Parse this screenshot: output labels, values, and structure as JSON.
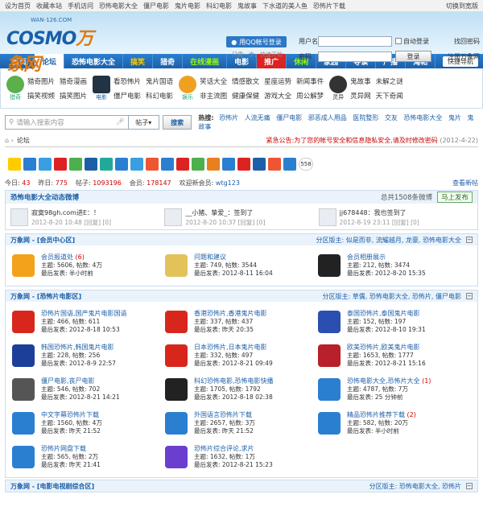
{
  "topbar": {
    "links": [
      "设为首页",
      "收藏本站",
      "手机访问",
      "恐怖电影大全",
      "僵尸电影",
      "鬼片电影",
      "科幻电影",
      "鬼故事",
      "下水道的美人鱼",
      "恐怖片下载"
    ],
    "right": "切换到宽版"
  },
  "header": {
    "logo_url": "WAN-126.COM",
    "logo_brand": "COSMO",
    "logo_brand2": "万象网",
    "qq_button": "用QQ帐号登录",
    "qq_tip": "只需一步，快速开始",
    "username_label": "用户名",
    "password_label": "密码",
    "auto_login": "自动登录",
    "find_password": "找回密码",
    "login_button": "登录",
    "register": "注册万象网"
  },
  "nav": {
    "items": [
      "首页",
      "论坛",
      "恐怖电影大全",
      "搞笑",
      "猎奇",
      "在线漫画",
      "电影",
      "推广",
      "休闲",
      "家园",
      "导读",
      "广播",
      "淘帖"
    ],
    "quick": "快捷导航"
  },
  "subnav": {
    "groups": [
      {
        "icon_label": "猎奇",
        "links": [
          "猎奇图片",
          "猎奇漫画",
          "搞笑视频",
          "搞笑图片"
        ]
      },
      {
        "icon_label": "电影",
        "links": [
          "看恐怖片",
          "鬼片国语",
          "僵尸电影",
          "科幻电影"
        ]
      },
      {
        "icon_label": "娱乐",
        "links": [
          "笑话大全",
          "情感散文",
          "星座运势",
          "新闻事件",
          "非主流图",
          "健康保健",
          "游戏大全",
          "周公解梦"
        ]
      },
      {
        "icon_label": "灵异",
        "links": [
          "鬼故事",
          "未解之谜",
          "灵异网",
          "天下奇闻"
        ]
      }
    ]
  },
  "search": {
    "placeholder": "请输入搜索内容",
    "select": "帖子",
    "button": "搜索",
    "hot_label": "热搜:",
    "hot": [
      "恐怖片",
      "人流无痛",
      "僵尸电影",
      "邪恶成人用品",
      "医院整形",
      "交友",
      "恐怖电影大全",
      "鬼片",
      "鬼故事"
    ]
  },
  "notice": {
    "breadcrumb": "论坛",
    "announce": "紧急公告:为了您的帐号安全和信息隐私安全,请及时修改密码",
    "date": "(2012-4-22)"
  },
  "icons_count": "558",
  "stats": {
    "today_label": "今日:",
    "today": "43",
    "yesterday_label": "昨日:",
    "yesterday": "775",
    "posts_label": "帖子:",
    "posts": "1093196",
    "members_label": "会员:",
    "members": "178147",
    "newest_label": "欢迎新会员:",
    "newest": "wtg123",
    "new_posts": "查看新帖"
  },
  "weibo": {
    "title": "恐怖电影大全动态微博",
    "total": "总共1508条微博",
    "publish": "马上发布",
    "items": [
      {
        "text": "寂寞98gh.com进E：！",
        "time": "2012-8-20 10:48 [回复] [0]"
      },
      {
        "text": "__小猪、挚爱_：签到了",
        "time": "2012-8-20 10:37 [回复] [0]"
      },
      {
        "text": "jj678448：我也签到了",
        "time": "2012-8-19 23:11 [回复] [0]"
      }
    ]
  },
  "sections": [
    {
      "title": "万象网 - [会员中心区]",
      "mods_label": "分区版主:",
      "mods": "似是而非, 流耀越月, 龙豪, 恐怖电影大全",
      "forums": [
        {
          "name": "会员报道处",
          "new": "(6)",
          "topics": "主题: 5606, 帖数: 4万",
          "last": "最后发表: 半小时前",
          "color": "#f3a21b"
        },
        {
          "name": "问题和建议",
          "new": "",
          "topics": "主题: 749, 帖数: 3544",
          "last": "最后发表: 2012-8-11 16:04",
          "color": "#e3c25a"
        },
        {
          "name": "会员相册展示",
          "new": "",
          "topics": "主题: 212, 帖数: 3474",
          "last": "最后发表: 2012-8-20 15:35",
          "color": "#222"
        }
      ]
    },
    {
      "title": "万象网 - [恐怖片电影区]",
      "mods_label": "分区版主:",
      "mods": "草儒, 恐怖电影大全, 恐怖片, 僵尸电影",
      "forums": [
        {
          "name": "恐怖片国语,国产鬼片电影国语",
          "new": "",
          "topics": "主题: 466, 帖数: 611",
          "last": "最后发表: 2012-8-18 10:53",
          "color": "#d9261c"
        },
        {
          "name": "香港恐怖片,香港鬼片电影",
          "new": "",
          "topics": "主题: 337, 帖数: 437",
          "last": "最后发表: 昨天 20:35",
          "color": "#d9261c"
        },
        {
          "name": "泰国恐怖片,泰国鬼片电影",
          "new": "",
          "topics": "主题: 152, 帖数: 197",
          "last": "最后发表: 2012-8-10 19:31",
          "color": "#2a4fb0"
        },
        {
          "name": "韩国恐怖片,韩国鬼片电影",
          "new": "",
          "topics": "主题: 228, 帖数: 256",
          "last": "最后发表: 2012-8-9 22:57",
          "color": "#1c3f9a"
        },
        {
          "name": "日本恐怖片,日本鬼片电影",
          "new": "",
          "topics": "主题: 332, 帖数: 497",
          "last": "最后发表: 2012-8-21 09:49",
          "color": "#d9261c"
        },
        {
          "name": "欧美恐怖片,欧美鬼片电影",
          "new": "",
          "topics": "主题: 1653, 帖数: 1777",
          "last": "最后发表: 2012-8-21 15:16",
          "color": "#b8202a"
        },
        {
          "name": "僵尸电影,丧尸电影",
          "new": "",
          "topics": "主题: 546, 帖数: 702",
          "last": "最后发表: 2012-8-21 14:21",
          "color": "#555"
        },
        {
          "name": "科幻恐怖电影,恐怖电影快播",
          "new": "",
          "topics": "主题: 1705, 帖数: 1792",
          "last": "最后发表: 2012-8-18 02:38",
          "color": "#222"
        },
        {
          "name": "恐怖电影大全,恐怖片大全",
          "new": "(1)",
          "topics": "主题: 4787, 帖数: 7万",
          "last": "最后发表: 25 分钟前",
          "color": "#2a7fd0"
        },
        {
          "name": "中文字幕恐怖片下载",
          "new": "",
          "topics": "主题: 1560, 帖数: 4万",
          "last": "最后发表: 昨天 21:52",
          "color": "#2a7fd0"
        },
        {
          "name": "外国语言恐怖片下载",
          "new": "",
          "topics": "主题: 2657, 帖数: 3万",
          "last": "最后发表: 昨天 21:52",
          "color": "#2a7fd0"
        },
        {
          "name": "精品恐怖片推荐下载",
          "new": "(2)",
          "topics": "主题: 582, 帖数: 20万",
          "last": "最后发表: 半小时前",
          "color": "#2a7fd0"
        },
        {
          "name": "恐怖片网盘下载",
          "new": "",
          "topics": "主题: 565, 帖数: 2万",
          "last": "最后发表: 昨天 21:41",
          "color": "#2a7fd0"
        },
        {
          "name": "恐怖片综合评论,求片",
          "new": "",
          "topics": "主题: 1632, 帖数: 1万",
          "last": "最后发表: 2012-8-21 15:23",
          "color": "#6a3fd0"
        }
      ]
    }
  ],
  "last_section": {
    "title": "万象网 - [电影电视剧综合区]",
    "mods_label": "分区版主:",
    "mods": "恐怖电影大全, 恐怖片"
  }
}
